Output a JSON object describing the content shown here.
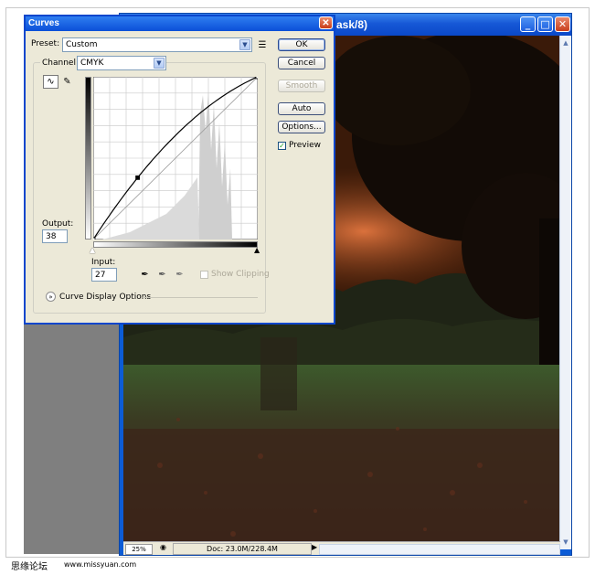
{
  "document_window": {
    "title_fragment": "ask/8)",
    "status": {
      "zoom": "25%",
      "doc_info": "Doc: 23.0M/228.4M"
    }
  },
  "curves_dialog": {
    "title": "Curves",
    "preset_label": "Preset:",
    "preset_value": "Custom",
    "channel_label": "Channel:",
    "channel_value": "CMYK",
    "buttons": {
      "ok": "OK",
      "cancel": "Cancel",
      "smooth": "Smooth",
      "auto": "Auto",
      "options": "Options..."
    },
    "preview_label": "Preview",
    "preview_checked": true,
    "output_label": "Output:",
    "output_value": "38",
    "input_label": "Input:",
    "input_value": "27",
    "show_clipping_label": "Show Clipping",
    "curve_display_options_label": "Curve Display Options",
    "curve": {
      "control_points": [
        [
          0,
          0
        ],
        [
          27,
          38
        ],
        [
          100,
          100
        ]
      ]
    }
  },
  "watermark": {
    "left": "思缘论坛",
    "right": "www.missyuan.com"
  },
  "colors": {
    "titlebar": "#0a4fd8",
    "dialog_bg": "#ece9d8",
    "close_button": "#c93f1c"
  }
}
